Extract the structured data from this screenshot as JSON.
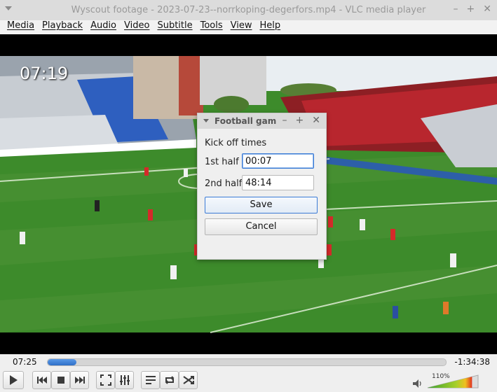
{
  "window": {
    "title": "Wyscout footage - 2023-07-23--norrkoping-degerfors.mp4 - VLC media player"
  },
  "menu": [
    "Media",
    "Playback",
    "Audio",
    "Video",
    "Subtitle",
    "Tools",
    "View",
    "Help"
  ],
  "video": {
    "timecode_overlay": "07:19"
  },
  "dialog": {
    "title": "Football game",
    "heading": "Kick off times",
    "first_half_label": "1st half",
    "first_half_value": "00:07",
    "second_half_label": "2nd half",
    "second_half_value": "48:14",
    "save_label": "Save",
    "cancel_label": "Cancel"
  },
  "seek": {
    "elapsed": "07:25",
    "remaining": "-1:34:38",
    "progress": 0.073
  },
  "volume": {
    "level": "110%",
    "fraction": 1.1
  },
  "colors": {
    "accent": "#3b7bd6",
    "pitch": "#3f8a2c",
    "stands_red": "#c8202a",
    "seat_blue": "#2f5fb8"
  },
  "icons": [
    "play-icon",
    "previous-icon",
    "stop-icon",
    "next-icon",
    "fullscreen-icon",
    "extended-settings-icon",
    "playlist-icon",
    "loop-icon",
    "shuffle-icon",
    "speaker-icon"
  ]
}
